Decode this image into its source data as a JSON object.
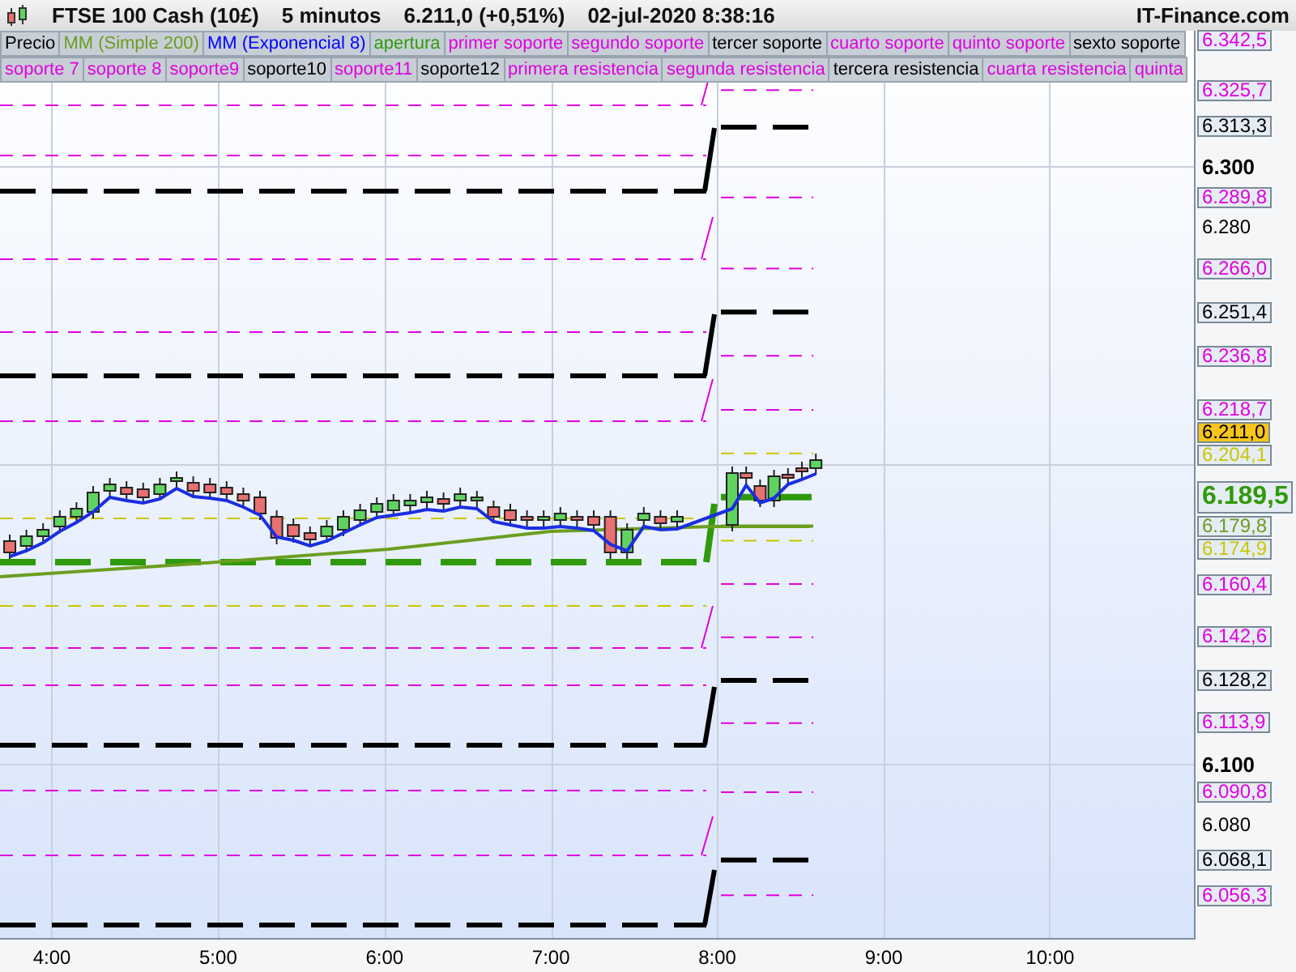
{
  "header": {
    "title": "FTSE 100 Cash (10£)",
    "timeframe": "5 minutos",
    "price": "6.211,0 (+0,51%)",
    "datetime": "02-jul-2020 8:38:16",
    "brand": "IT-Finance.com"
  },
  "legend": [
    [
      {
        "label": "Precio",
        "color": "#000000"
      },
      {
        "label": "MM (Simple 200)",
        "color": "#6b9e1f"
      },
      {
        "label": "MM (Exponencial 8)",
        "color": "#0000ff"
      },
      {
        "label": "apertura",
        "color": "#2f9a0c"
      },
      {
        "label": "primer soporte",
        "color": "#e000e0"
      },
      {
        "label": "segundo soporte",
        "color": "#e000e0"
      },
      {
        "label": "tercer soporte",
        "color": "#000000"
      },
      {
        "label": "cuarto soporte",
        "color": "#e000e0"
      },
      {
        "label": "quinto soporte",
        "color": "#e000e0"
      },
      {
        "label": "sexto soporte",
        "color": "#000000"
      }
    ],
    [
      {
        "label": "soporte 7",
        "color": "#e000e0"
      },
      {
        "label": "soporte 8",
        "color": "#e000e0"
      },
      {
        "label": "soporte9",
        "color": "#e000e0"
      },
      {
        "label": "soporte10",
        "color": "#000000"
      },
      {
        "label": "soporte11",
        "color": "#e000e0"
      },
      {
        "label": "soporte12",
        "color": "#000000"
      },
      {
        "label": "primera resistencia",
        "color": "#e000e0"
      },
      {
        "label": "segunda resistencia",
        "color": "#e000e0"
      },
      {
        "label": "tercera resistencia",
        "color": "#000000"
      },
      {
        "label": "cuarta resistencia",
        "color": "#e000e0"
      },
      {
        "label": "quinta",
        "color": "#e000e0"
      }
    ]
  ],
  "ticks": [
    {
      "label": "6.300",
      "kind": "major"
    },
    {
      "label": "6.280",
      "kind": "minor"
    },
    {
      "label": "6.100",
      "kind": "major"
    },
    {
      "label": "6.080",
      "kind": "minor"
    }
  ],
  "tags": [
    {
      "label": "6.342,5",
      "kind": "thin",
      "color": "#e000e0"
    },
    {
      "label": "6.325,7",
      "kind": "thin",
      "color": "#e000e0"
    },
    {
      "label": "6.313,3",
      "kind": "thick",
      "color": "#000000"
    },
    {
      "label": "6.289,8",
      "kind": "thin",
      "color": "#e000e0"
    },
    {
      "label": "6.266,0",
      "kind": "thin",
      "color": "#e000e0"
    },
    {
      "label": "6.251,4",
      "kind": "thick",
      "color": "#000000"
    },
    {
      "label": "6.236,8",
      "kind": "thin",
      "color": "#e000e0"
    },
    {
      "label": "6.218,7",
      "kind": "thin",
      "color": "#e000e0"
    },
    {
      "label": "6.211,0",
      "kind": "current",
      "color": "#f7c51c"
    },
    {
      "label": "6.204,1",
      "kind": "thin",
      "color": "#c8c800"
    },
    {
      "label": "6.189,5",
      "kind": "open",
      "color": "#2f9a0c"
    },
    {
      "label": "6.179,8",
      "kind": "solid",
      "color": "#6b9e1f"
    },
    {
      "label": "6.174,9",
      "kind": "thin",
      "color": "#c8c800"
    },
    {
      "label": "6.160,4",
      "kind": "thin",
      "color": "#e000e0"
    },
    {
      "label": "6.142,6",
      "kind": "thin",
      "color": "#e000e0"
    },
    {
      "label": "6.128,2",
      "kind": "thick",
      "color": "#000000"
    },
    {
      "label": "6.113,9",
      "kind": "thin",
      "color": "#e000e0"
    },
    {
      "label": "6.090,8",
      "kind": "thin",
      "color": "#e000e0"
    },
    {
      "label": "6.068,1",
      "kind": "thick",
      "color": "#000000"
    },
    {
      "label": "6.056,3",
      "kind": "thin",
      "color": "#e000e0"
    }
  ],
  "times": [
    "4:00",
    "5:00",
    "6:00",
    "7:00",
    "8:00",
    "9:00",
    "10:00"
  ]
}
